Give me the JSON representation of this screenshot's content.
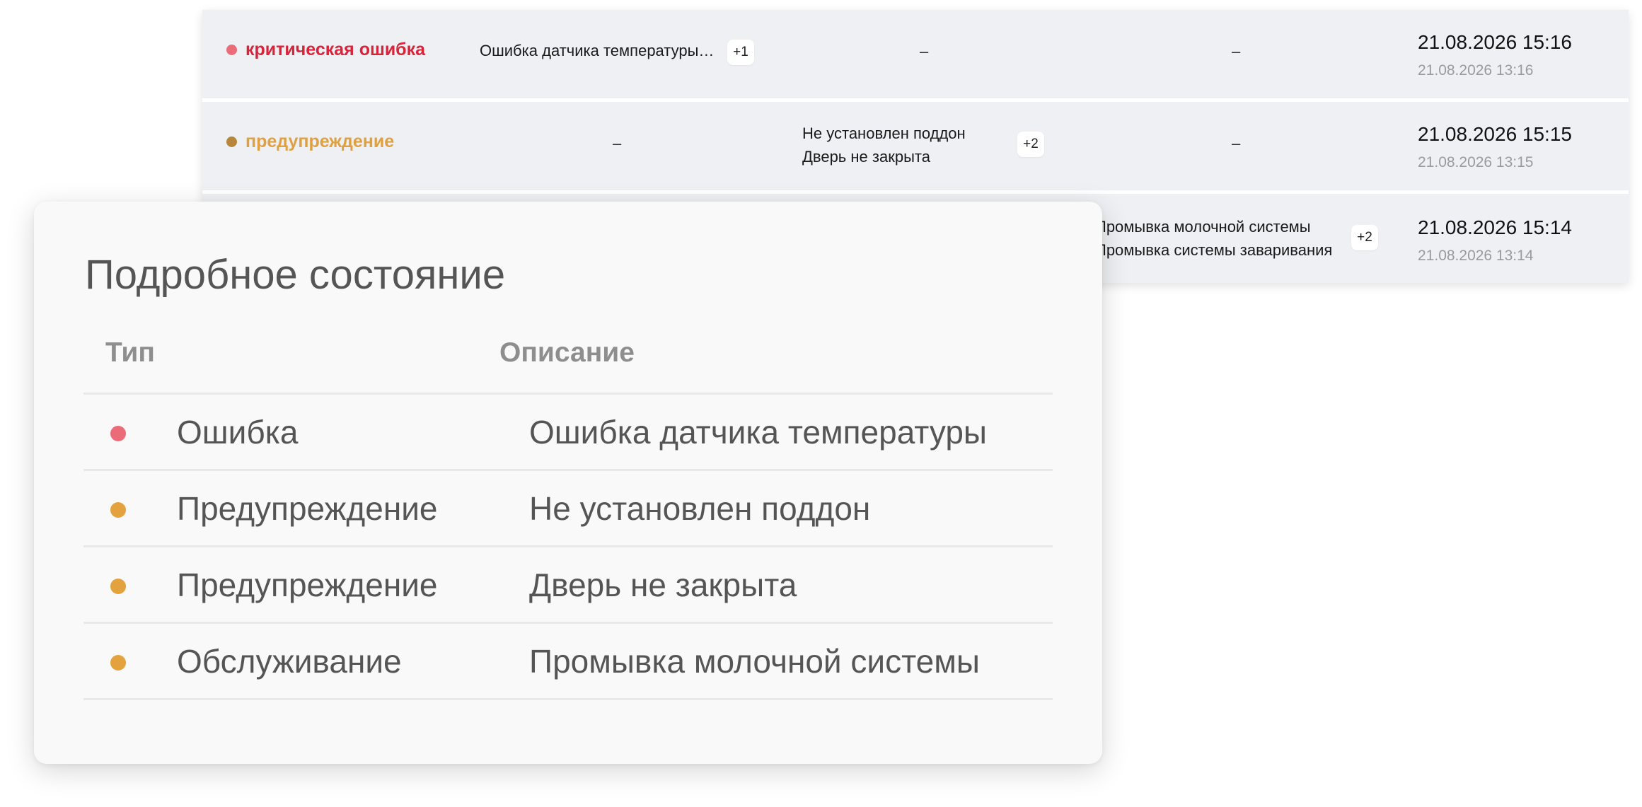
{
  "colors": {
    "critical": "#d8233a",
    "critical_dot": "#ec6b78",
    "warning_text": "#e0a040",
    "warning_dot_bg": "#b8863a",
    "warning_dot": "#e3a23d",
    "muted": "#9a9a9a"
  },
  "events": [
    {
      "status": "критическая ошибка",
      "errors": "Ошибка датчика температуры…",
      "errors_more": "+1",
      "warnings": "–",
      "maintenance": "–",
      "time_main": "21.08.2026 15:16",
      "time_sub": "21.08.2026 13:16"
    },
    {
      "status": "предупреждение",
      "errors": "–",
      "warnings_lines": [
        "Не установлен поддон",
        "Дверь не закрыта"
      ],
      "warnings_more": "+2",
      "maintenance": "–",
      "time_main": "21.08.2026 15:15",
      "time_sub": "21.08.2026 13:15"
    },
    {
      "maintenance_lines": [
        "Промывка молочной системы",
        "Промывка системы заваривания"
      ],
      "maintenance_more": "+2",
      "time_main": "21.08.2026 15:14",
      "time_sub": "21.08.2026 13:14"
    }
  ],
  "details": {
    "title": "Подробное состояние",
    "col_type": "Тип",
    "col_desc": "Описание",
    "rows": [
      {
        "type": "Ошибка",
        "description": "Ошибка датчика температуры",
        "level": "error"
      },
      {
        "type": "Предупреждение",
        "description": "Не установлен поддон",
        "level": "warning"
      },
      {
        "type": "Предупреждение",
        "description": "Дверь не закрыта",
        "level": "warning"
      },
      {
        "type": "Обслуживание",
        "description": "Промывка молочной системы",
        "level": "maintenance"
      }
    ]
  }
}
